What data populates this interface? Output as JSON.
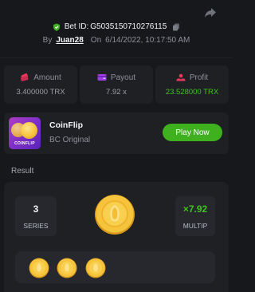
{
  "header": {
    "bet_id_label": "Bet ID:",
    "bet_id": "G5035150710276115",
    "by_label": "By",
    "user": "Juan28",
    "on_label": "On",
    "datetime": "6/14/2022, 10:17:50 AM"
  },
  "stats": [
    {
      "icon": "amount-icon",
      "label": "Amount",
      "value": "3.400000 TRX",
      "highlight": false
    },
    {
      "icon": "payout-icon",
      "label": "Payout",
      "value": "7.92 x",
      "highlight": false
    },
    {
      "icon": "profit-icon",
      "label": "Profit",
      "value": "23.528000 TRX",
      "highlight": true
    }
  ],
  "game": {
    "thumbnail_text": "COINFLIP",
    "name": "CoinFlip",
    "provider": "BC Original",
    "play_label": "Play Now"
  },
  "result": {
    "title": "Result",
    "series_value": "3",
    "series_label": "SERIES",
    "multiplier_value": "×7.92",
    "multiplier_label": "MULTIP",
    "coins_count": 3
  },
  "colors": {
    "background": "#17181b",
    "panel": "#1f2024",
    "accent_green": "#3fb11f",
    "profit_green": "#3fc31d",
    "coin_gold": "#f6c43c"
  }
}
